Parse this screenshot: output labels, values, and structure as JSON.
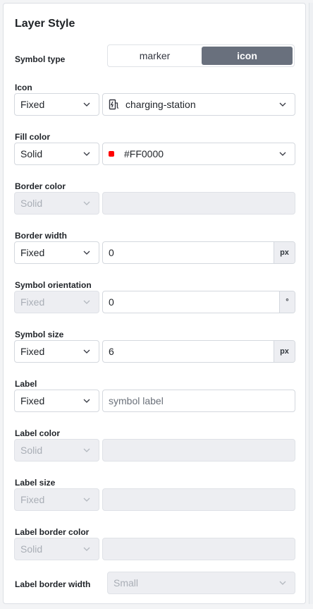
{
  "panel": {
    "title": "Layer Style"
  },
  "symbol_type": {
    "label": "Symbol type",
    "options": [
      "marker",
      "icon"
    ],
    "selected": "icon"
  },
  "icon": {
    "label": "Icon",
    "mode": "Fixed",
    "value": "charging-station",
    "icon": "charging-station-icon"
  },
  "fill_color": {
    "label": "Fill color",
    "mode": "Solid",
    "value": "#FF0000",
    "swatch": "#FF0000"
  },
  "border_color": {
    "label": "Border color",
    "mode": "Solid",
    "value": ""
  },
  "border_width": {
    "label": "Border width",
    "mode": "Fixed",
    "value": "0",
    "unit": "px"
  },
  "symbol_orientation": {
    "label": "Symbol orientation",
    "mode": "Fixed",
    "value": "0",
    "unit": "°"
  },
  "symbol_size": {
    "label": "Symbol size",
    "mode": "Fixed",
    "value": "6",
    "unit": "px"
  },
  "label": {
    "label": "Label",
    "mode": "Fixed",
    "placeholder": "symbol label"
  },
  "label_color": {
    "label": "Label color",
    "mode": "Solid",
    "value": ""
  },
  "label_size": {
    "label": "Label size",
    "mode": "Fixed",
    "value": ""
  },
  "label_border_color": {
    "label": "Label border color",
    "mode": "Solid",
    "value": ""
  },
  "label_border_width": {
    "label": "Label border width",
    "value": "Small"
  }
}
